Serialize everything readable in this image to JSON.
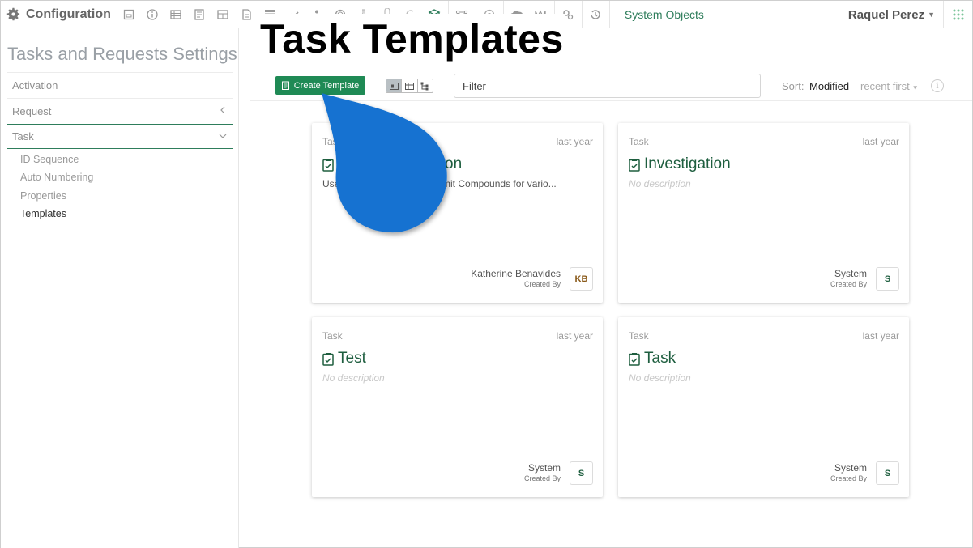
{
  "topbar": {
    "app_title": "Configuration",
    "toolbar_icons": [
      "form-icon",
      "info-icon",
      "table-icon",
      "document-list-icon",
      "grid-icon",
      "file-icon",
      "stack-icon",
      "chart-icon",
      "tree-icon",
      "target-icon",
      "flask-icon",
      "person-icon",
      "refresh-icon",
      "cube-icon",
      "network-icon",
      "circle-icon",
      "cloud-icon",
      "wave-icon",
      "gears-icon",
      "history-icon"
    ],
    "system_objects": "System Objects",
    "user_name": "Raquel Perez"
  },
  "sidebar": {
    "title": "Tasks and Requests Settings",
    "items": [
      {
        "label": "Activation"
      },
      {
        "label": "Request"
      },
      {
        "label": "Task"
      }
    ],
    "task_subitems": [
      {
        "label": "ID Sequence"
      },
      {
        "label": "Auto Numbering"
      },
      {
        "label": "Properties"
      },
      {
        "label": "Templates"
      }
    ]
  },
  "heading": "Task Templates",
  "actions": {
    "create_label": "Create Template",
    "filter_placeholder": "Filter",
    "sort_label": "Sort:",
    "sort_value": "Modified",
    "sort_direction": "recent first"
  },
  "cards": [
    {
      "type": "Task",
      "time": "last year",
      "title": "Compound Registration",
      "title_visible": "on",
      "description": "Used for Compounds as Submit Compounds for vario...",
      "desc_visible_a": "Use",
      "desc_visible_b": "bmit Compounds for vario...",
      "creator": "Katherine Benavides",
      "creator_role": "Created By",
      "avatar": "KB"
    },
    {
      "type": "Task",
      "time": "last year",
      "title": "Investigation",
      "description": "No description",
      "creator": "System",
      "creator_role": "Created By",
      "avatar": "S"
    },
    {
      "type": "Task",
      "time": "last year",
      "title": "Test",
      "description": "No description",
      "creator": "System",
      "creator_role": "Created By",
      "avatar": "S"
    },
    {
      "type": "Task",
      "time": "last year",
      "title": "Task",
      "description": "No description",
      "creator": "System",
      "creator_role": "Created By",
      "avatar": "S"
    }
  ],
  "colors": {
    "accent_green": "#1f8a55",
    "title_green": "#1e5e3f",
    "callout_blue": "#1372d1"
  }
}
